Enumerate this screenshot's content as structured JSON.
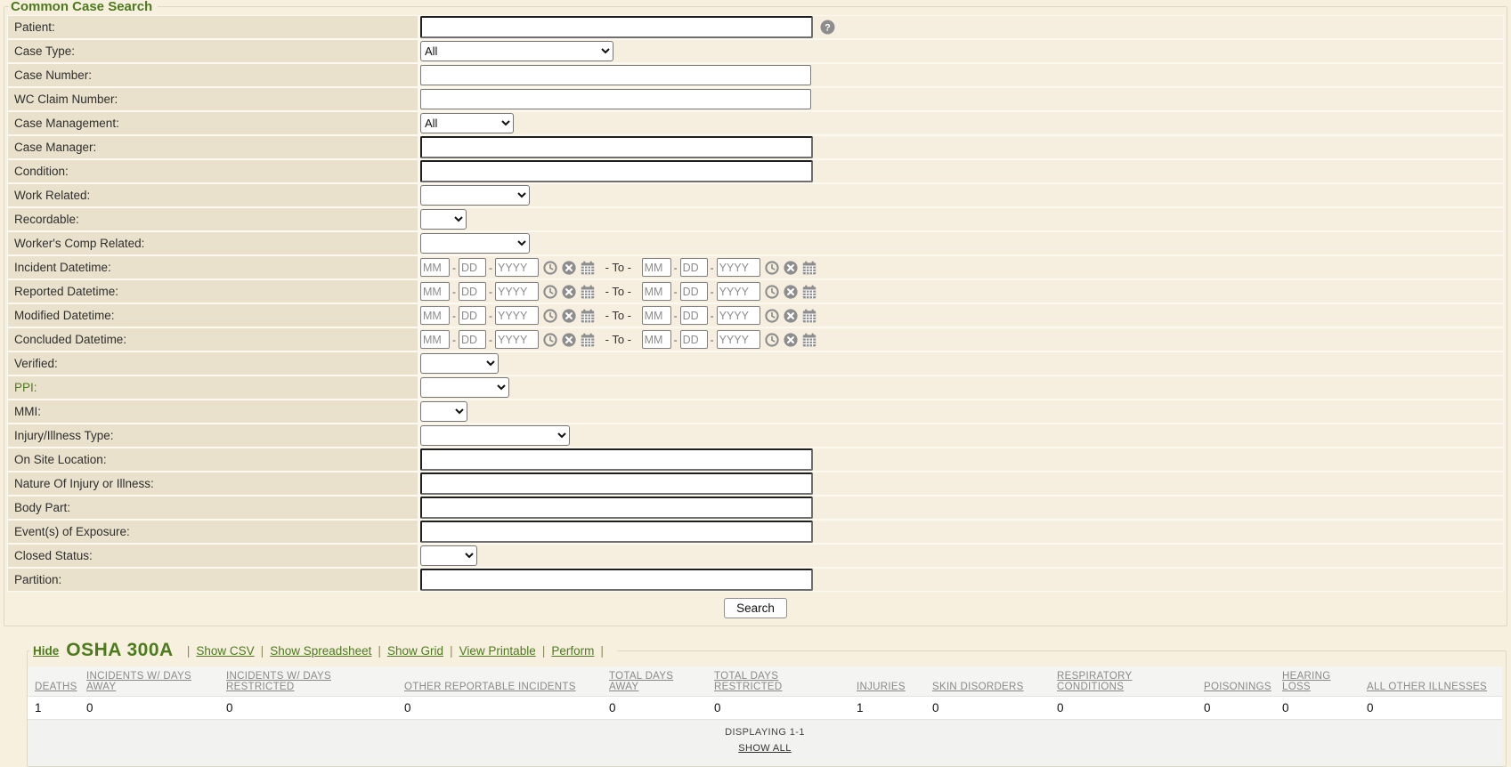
{
  "search": {
    "title": "Common Case Search",
    "labels": [
      "Patient:",
      "Case Type:",
      "Case Number:",
      "WC Claim Number:",
      "Case Management:",
      "Case Manager:",
      "Condition:",
      "Work Related:",
      "Recordable:",
      "Worker's Comp Related:",
      "Incident Datetime:",
      "Reported Datetime:",
      "Modified Datetime:",
      "Concluded Datetime:",
      "Verified:",
      "PPI:",
      "MMI:",
      "Injury/Illness Type:",
      "On Site Location:",
      "Nature Of Injury or Illness:",
      "Body Part:",
      "Event(s) of Exposure:",
      "Closed Status:",
      "Partition:"
    ],
    "case_type_value": "All",
    "case_management_value": "All",
    "search_button": "Search",
    "help_icon": "question-mark-circle"
  },
  "dates": {
    "mm": "MM",
    "dd": "DD",
    "yyyy": "YYYY",
    "to": " - To - ",
    "icons": [
      "clock",
      "clear-x",
      "calendar"
    ]
  },
  "osha": {
    "hide": "Hide",
    "title": "OSHA 300A",
    "separator": "|",
    "links": [
      "Show CSV",
      "Show Spreadsheet",
      "Show Grid",
      "View Printable",
      "Perform"
    ],
    "table": {
      "columns": [
        "DEATHS",
        "INCIDENTS W/ DAYS AWAY",
        "INCIDENTS W/ DAYS RESTRICTED",
        "OTHER REPORTABLE INCIDENTS",
        "TOTAL DAYS AWAY",
        "TOTAL DAYS RESTRICTED",
        "INJURIES",
        "SKIN DISORDERS",
        "RESPIRATORY CONDITIONS",
        "POISONINGS",
        "HEARING LOSS",
        "ALL OTHER ILLNESSES"
      ],
      "row": [
        "1",
        "0",
        "0",
        "0",
        "0",
        "0",
        "1",
        "0",
        "0",
        "0",
        "0",
        "0"
      ],
      "displaying": "DISPLAYING 1-1",
      "show_all": "SHOW ALL"
    }
  },
  "colors": {
    "accent_green": "#4c7a1d",
    "label_cell_bg": "#e9e1cb",
    "value_cell_bg": "#f6efdf",
    "icon_gray": "#8d8d8d"
  }
}
